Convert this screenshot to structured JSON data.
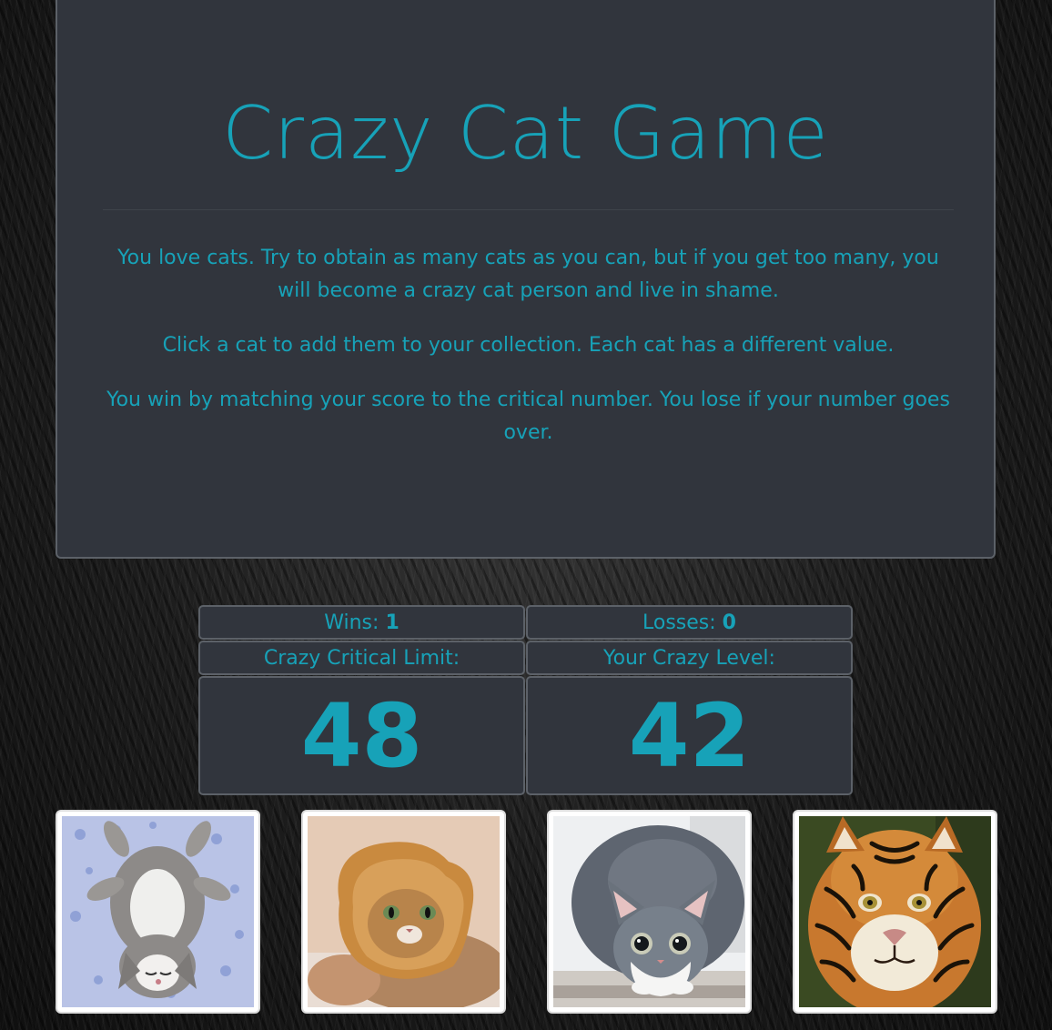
{
  "header": {
    "title": "Crazy Cat Game",
    "instructions": [
      "You love cats. Try to obtain as many cats as you can, but if you get too many, you will become a crazy cat person and live in shame.",
      "Click a cat to add them to your collection. Each cat has a different value.",
      "You win by matching your score to the critical number. You lose if your number goes over."
    ]
  },
  "scoreboard": {
    "wins_label": "Wins: ",
    "wins": "1",
    "losses_label": "Losses: ",
    "losses": "0",
    "limit_label": "Crazy Critical Limit:",
    "limit_value": "48",
    "level_label": "Your Crazy Level:",
    "level_value": "42"
  },
  "cats": [
    {
      "icon": "kitten-belly-up-icon",
      "bg": "#b9c3e6"
    },
    {
      "icon": "bread-cat-icon",
      "bg": "#e5cbb6"
    },
    {
      "icon": "tabby-crouching-icon",
      "bg": "#eef0f2"
    },
    {
      "icon": "tiger-icon",
      "bg": "#3a4a22"
    }
  ],
  "colors": {
    "accent": "#17a2b8",
    "panel": "#31353d",
    "border": "#5c6168"
  }
}
